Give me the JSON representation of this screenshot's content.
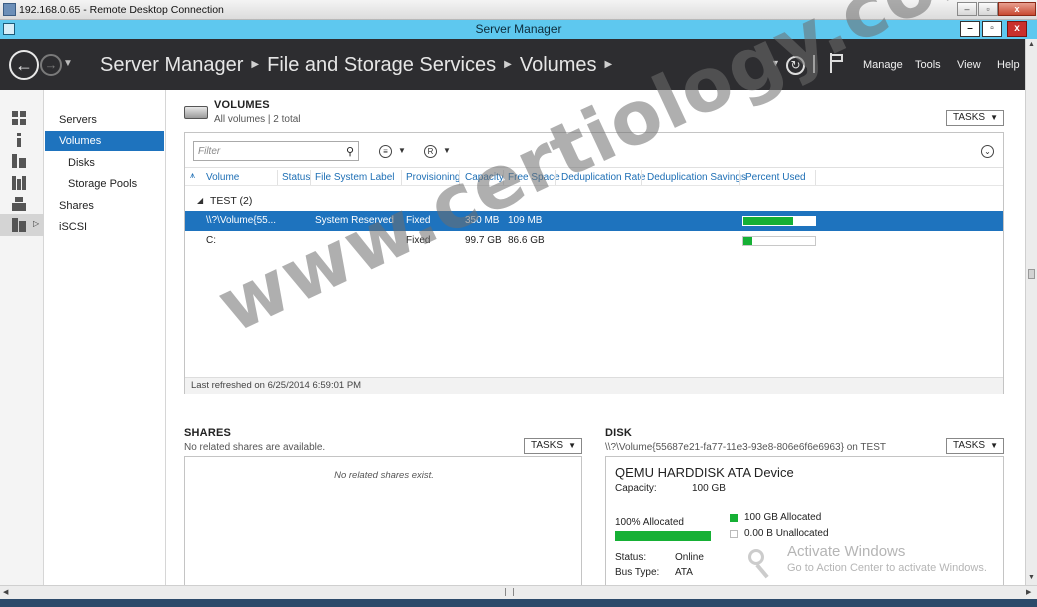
{
  "rdp": {
    "title": "192.168.0.65 - Remote Desktop Connection",
    "buttons": {
      "minimize": "–",
      "restore": "▫",
      "close": "x"
    }
  },
  "window": {
    "title": "Server Manager",
    "buttons": {
      "minimize": "–",
      "restore": "▫",
      "close": "x"
    }
  },
  "header": {
    "breadcrumb": [
      "Server Manager",
      "File and Storage Services",
      "Volumes"
    ],
    "menu": {
      "manage": "Manage",
      "tools": "Tools",
      "view": "View",
      "help": "Help"
    }
  },
  "nav": {
    "items": [
      {
        "label": "Servers"
      },
      {
        "label": "Volumes"
      },
      {
        "label": "Disks"
      },
      {
        "label": "Storage Pools"
      },
      {
        "label": "Shares"
      },
      {
        "label": "iSCSI"
      }
    ],
    "active": "Volumes"
  },
  "volumes": {
    "title": "VOLUMES",
    "subtitle": "All volumes | 2 total",
    "tasks_label": "TASKS",
    "filter_placeholder": "Filter",
    "columns": [
      "Volume",
      "Status",
      "File System Label",
      "Provisioning",
      "Capacity",
      "Free Space",
      "Deduplication Rate",
      "Deduplication Savings",
      "Percent Used"
    ],
    "group_label": "TEST (2)",
    "rows": [
      {
        "volume": "\\\\?\\Volume{55...",
        "status": "",
        "label": "System Reserved",
        "provisioning": "Fixed",
        "capacity": "350 MB",
        "free": "109 MB",
        "dedup_rate": "",
        "dedup_savings": "",
        "percent_used": 0.69
      },
      {
        "volume": "C:",
        "status": "",
        "label": "",
        "provisioning": "Fixed",
        "capacity": "99.7 GB",
        "free": "86.6 GB",
        "dedup_rate": "",
        "dedup_savings": "",
        "percent_used": 0.13
      }
    ],
    "last_refreshed": "Last refreshed on 6/25/2014 6:59:01 PM"
  },
  "shares": {
    "title": "SHARES",
    "subtitle": "No related shares are available.",
    "tasks_label": "TASKS",
    "empty_message": "No related shares exist."
  },
  "disk": {
    "title": "DISK",
    "subtitle": "\\\\?\\Volume{55687e21-fa77-11e3-93e8-806e6f6e6963} on TEST",
    "tasks_label": "TASKS",
    "device_name": "QEMU HARDDISK ATA Device",
    "capacity_label": "Capacity:",
    "capacity_value": "100 GB",
    "allocated_label": "100% Allocated",
    "allocated_fraction": 1.0,
    "legend_allocated": "100 GB Allocated",
    "legend_unallocated": "0.00 B Unallocated",
    "status_label": "Status:",
    "status_value": "Online",
    "bus_label": "Bus Type:",
    "bus_value": "ATA"
  },
  "activation": {
    "title": "Activate Windows",
    "subtitle": "Go to Action Center to activate Windows."
  },
  "watermark": "www.certiology.com",
  "colors": {
    "accent": "#1e73be",
    "header_bg": "#2d2d30",
    "titlebar": "#5ec8ef",
    "usage_green": "#16b035"
  }
}
